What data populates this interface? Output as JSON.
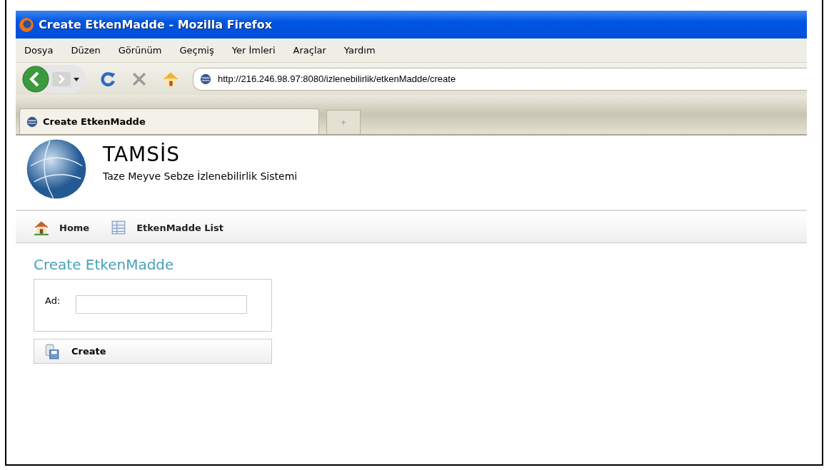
{
  "window": {
    "title": "Create EtkenMadde - Mozilla Firefox"
  },
  "menu": [
    "Dosya",
    "Düzen",
    "Görünüm",
    "Geçmiş",
    "Yer İmleri",
    "Araçlar",
    "Yardım"
  ],
  "address": {
    "value": "http://216.246.98.97:8080/izlenebilirlik/etkenMadde/create"
  },
  "tabs": [
    {
      "label": "Create EtkenMadde",
      "selected": true
    }
  ],
  "new_tab": "+",
  "header": {
    "title": "TAMSİS",
    "subtitle": "Taze Meyve Sebze İzlenebilirlik Sistemi"
  },
  "nav": [
    {
      "label": "Home",
      "kind": "home"
    },
    {
      "label": "EtkenMadde List",
      "kind": "list"
    }
  ],
  "page_title": "Create EtkenMadde",
  "form": {
    "fields": [
      {
        "label": "Ad:"
      }
    ],
    "button": "Create"
  }
}
